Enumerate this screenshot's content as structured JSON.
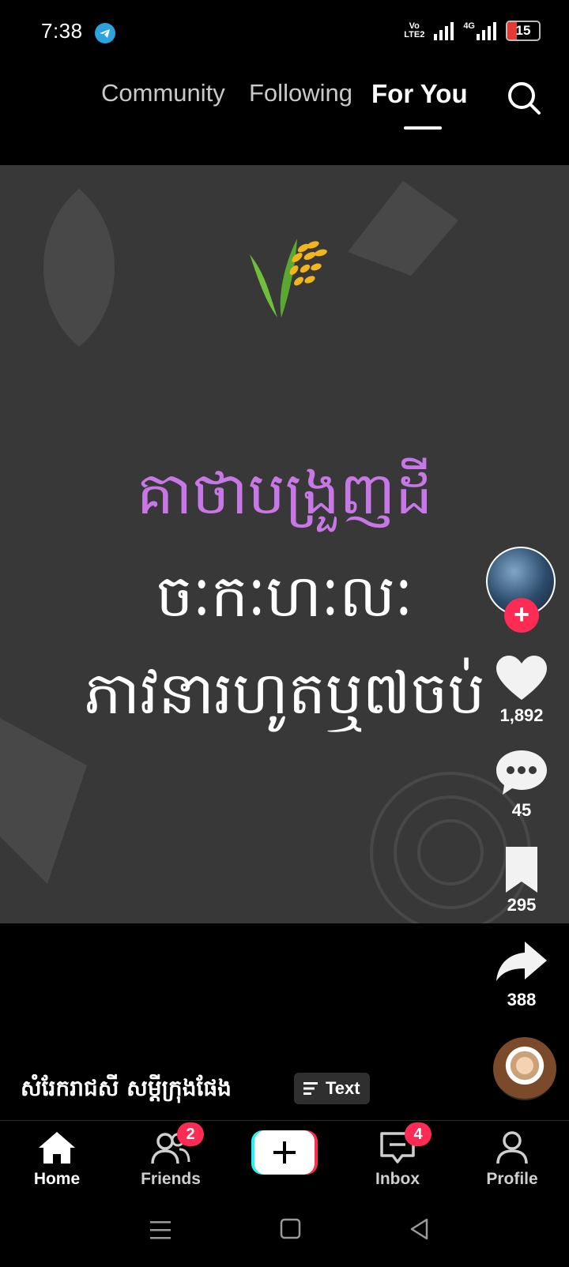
{
  "status_bar": {
    "time": "7:38",
    "volte_top": "Vo",
    "volte_bottom": "LTE2",
    "network": "4G",
    "battery": "15"
  },
  "top_tabs": {
    "community": "Community",
    "following": "Following",
    "for_you": "For You"
  },
  "video": {
    "line1": "គាថាបង្រួញដី",
    "line2": "ចៈកៈហៈលៈ",
    "line3": "ភាវនារហូតឬ៧ចប់"
  },
  "actions": {
    "likes": "1,892",
    "comments": "45",
    "saves": "295",
    "shares": "388"
  },
  "caption": {
    "author": "សំរែករាជសី សម្ដីក្រុងផែង",
    "badge": "Text"
  },
  "bottom_nav": {
    "home": "Home",
    "friends": "Friends",
    "friends_badge": "2",
    "inbox": "Inbox",
    "inbox_badge": "4",
    "profile": "Profile"
  },
  "colors": {
    "accent": "#fe2c55",
    "title_purple": "#c878e6",
    "video_bg": "#383838"
  }
}
